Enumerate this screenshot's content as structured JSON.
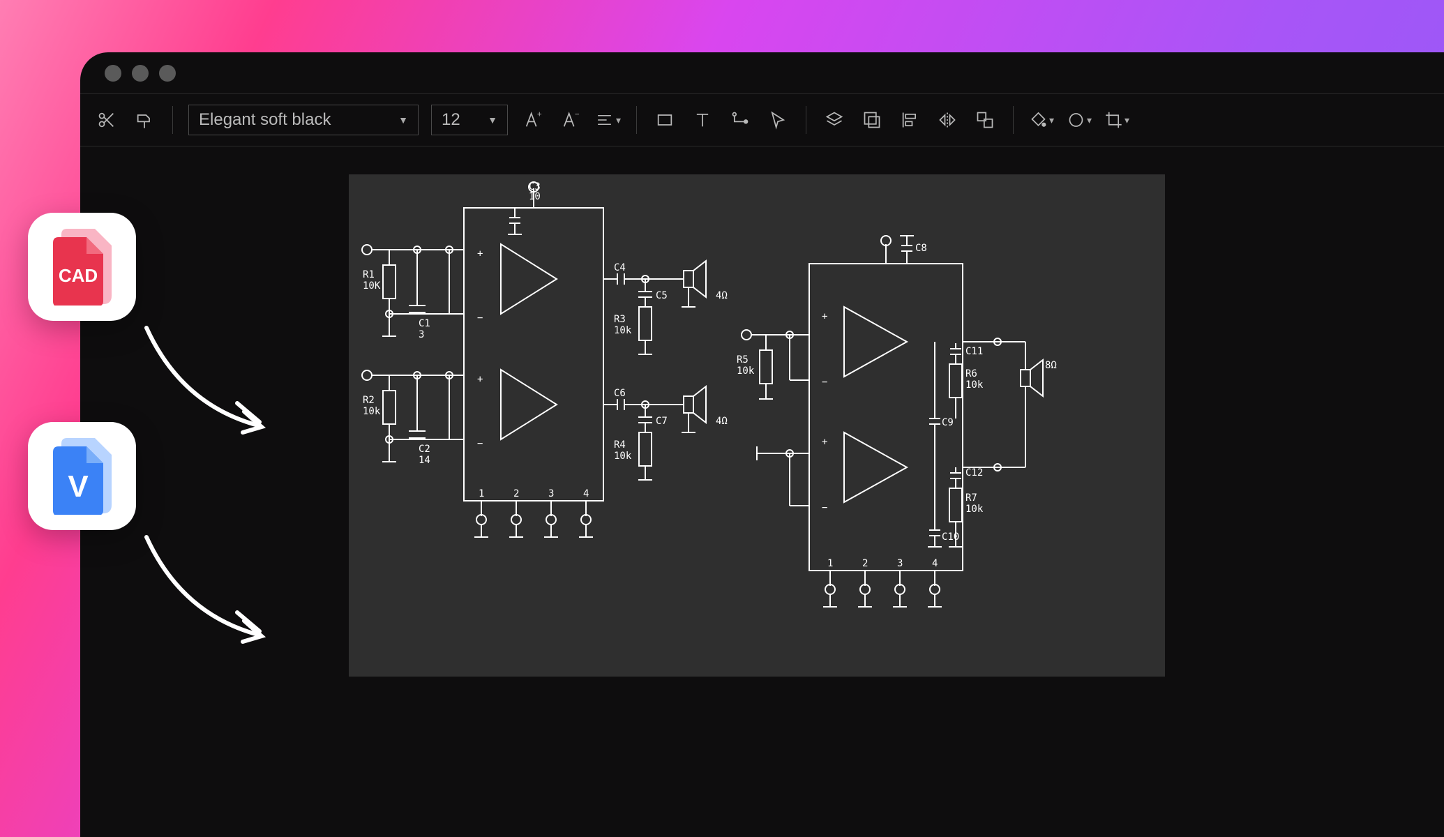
{
  "toolbar": {
    "font_name": "Elegant soft black",
    "font_size": "12"
  },
  "file_badges": {
    "cad": "CAD",
    "visio": "V"
  },
  "schematic": {
    "labels": {
      "c3": "C3",
      "c3_val": "10",
      "r1": "R1",
      "r1_val": "10K",
      "c1": "C1",
      "c1_val": "3",
      "r2": "R2",
      "r2_val": "10k",
      "c2": "C2",
      "c2_val": "14",
      "c4": "C4",
      "c5": "C5",
      "r3": "R3",
      "r3_val": "10k",
      "c6": "C6",
      "c7": "C7",
      "r4": "R4",
      "r4_val": "10k",
      "spk1": "4Ω",
      "spk2": "4Ω",
      "c8": "C8",
      "r5": "R5",
      "r5_val": "10k",
      "c9": "C9",
      "c10": "C10",
      "c11": "C11",
      "r6": "R6",
      "r6_val": "10k",
      "c12": "C12",
      "r7": "R7",
      "r7_val": "10k",
      "spk3": "8Ω",
      "pins": [
        "1",
        "2",
        "3",
        "4"
      ]
    }
  }
}
